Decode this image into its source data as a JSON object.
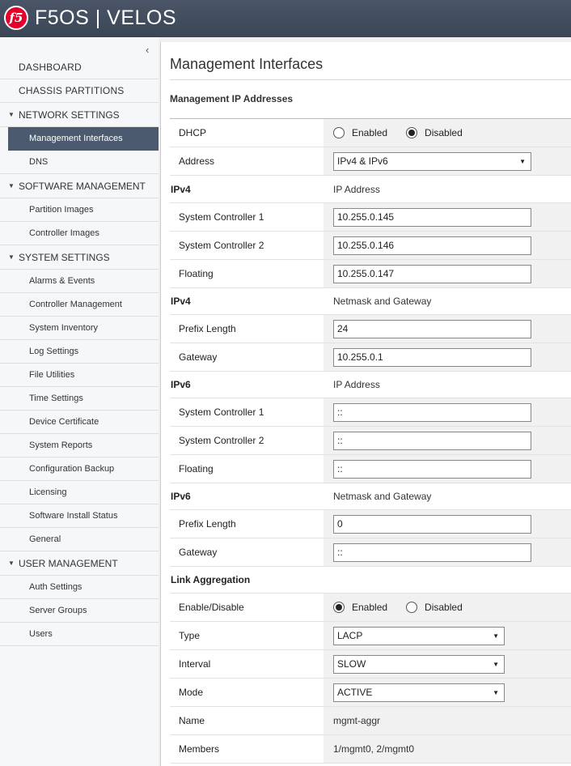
{
  "app": {
    "brand": "f5",
    "title": "F5OS | VELOS"
  },
  "sidebar": {
    "collapse_icon": "‹",
    "items": [
      {
        "label": "DASHBOARD",
        "kind": "top"
      },
      {
        "label": "CHASSIS PARTITIONS",
        "kind": "top"
      },
      {
        "label": "NETWORK SETTINGS",
        "kind": "section"
      },
      {
        "label": "Management Interfaces",
        "kind": "sub",
        "active": true
      },
      {
        "label": "DNS",
        "kind": "sub"
      },
      {
        "label": "SOFTWARE MANAGEMENT",
        "kind": "section"
      },
      {
        "label": "Partition Images",
        "kind": "sub"
      },
      {
        "label": "Controller Images",
        "kind": "sub"
      },
      {
        "label": "SYSTEM SETTINGS",
        "kind": "section"
      },
      {
        "label": "Alarms & Events",
        "kind": "sub"
      },
      {
        "label": "Controller Management",
        "kind": "sub"
      },
      {
        "label": "System Inventory",
        "kind": "sub"
      },
      {
        "label": "Log Settings",
        "kind": "sub"
      },
      {
        "label": "File Utilities",
        "kind": "sub"
      },
      {
        "label": "Time Settings",
        "kind": "sub"
      },
      {
        "label": "Device Certificate",
        "kind": "sub"
      },
      {
        "label": "System Reports",
        "kind": "sub"
      },
      {
        "label": "Configuration Backup",
        "kind": "sub"
      },
      {
        "label": "Licensing",
        "kind": "sub"
      },
      {
        "label": "Software Install Status",
        "kind": "sub"
      },
      {
        "label": "General",
        "kind": "sub"
      },
      {
        "label": "USER MANAGEMENT",
        "kind": "section"
      },
      {
        "label": "Auth Settings",
        "kind": "sub"
      },
      {
        "label": "Server Groups",
        "kind": "sub"
      },
      {
        "label": "Users",
        "kind": "sub"
      }
    ]
  },
  "main": {
    "title": "Management Interfaces",
    "section_heading": "Management IP Addresses",
    "dhcp": {
      "label": "DHCP",
      "options": [
        "Enabled",
        "Disabled"
      ],
      "selected": "Disabled"
    },
    "address": {
      "label": "Address",
      "value": "IPv4 & IPv6"
    },
    "ipv4_ip": {
      "group": "IPv4",
      "sub": "IP Address",
      "sc1": {
        "label": "System Controller 1",
        "value": "10.255.0.145"
      },
      "sc2": {
        "label": "System Controller 2",
        "value": "10.255.0.146"
      },
      "floating": {
        "label": "Floating",
        "value": "10.255.0.147"
      }
    },
    "ipv4_nm": {
      "group": "IPv4",
      "sub": "Netmask and Gateway",
      "prefix": {
        "label": "Prefix Length",
        "value": "24"
      },
      "gateway": {
        "label": "Gateway",
        "value": "10.255.0.1"
      }
    },
    "ipv6_ip": {
      "group": "IPv6",
      "sub": "IP Address",
      "sc1": {
        "label": "System Controller 1",
        "value": "::"
      },
      "sc2": {
        "label": "System Controller 2",
        "value": "::"
      },
      "floating": {
        "label": "Floating",
        "value": "::"
      }
    },
    "ipv6_nm": {
      "group": "IPv6",
      "sub": "Netmask and Gateway",
      "prefix": {
        "label": "Prefix Length",
        "value": "0"
      },
      "gateway": {
        "label": "Gateway",
        "value": "::"
      }
    },
    "link_agg": {
      "group": "Link Aggregation",
      "enable": {
        "label": "Enable/Disable",
        "options": [
          "Enabled",
          "Disabled"
        ],
        "selected": "Enabled"
      },
      "type": {
        "label": "Type",
        "value": "LACP"
      },
      "interval": {
        "label": "Interval",
        "value": "SLOW"
      },
      "mode": {
        "label": "Mode",
        "value": "ACTIVE"
      },
      "name": {
        "label": "Name",
        "value": "mgmt-aggr"
      },
      "members": {
        "label": "Members",
        "value": "1/mgmt0, 2/mgmt0"
      }
    }
  }
}
